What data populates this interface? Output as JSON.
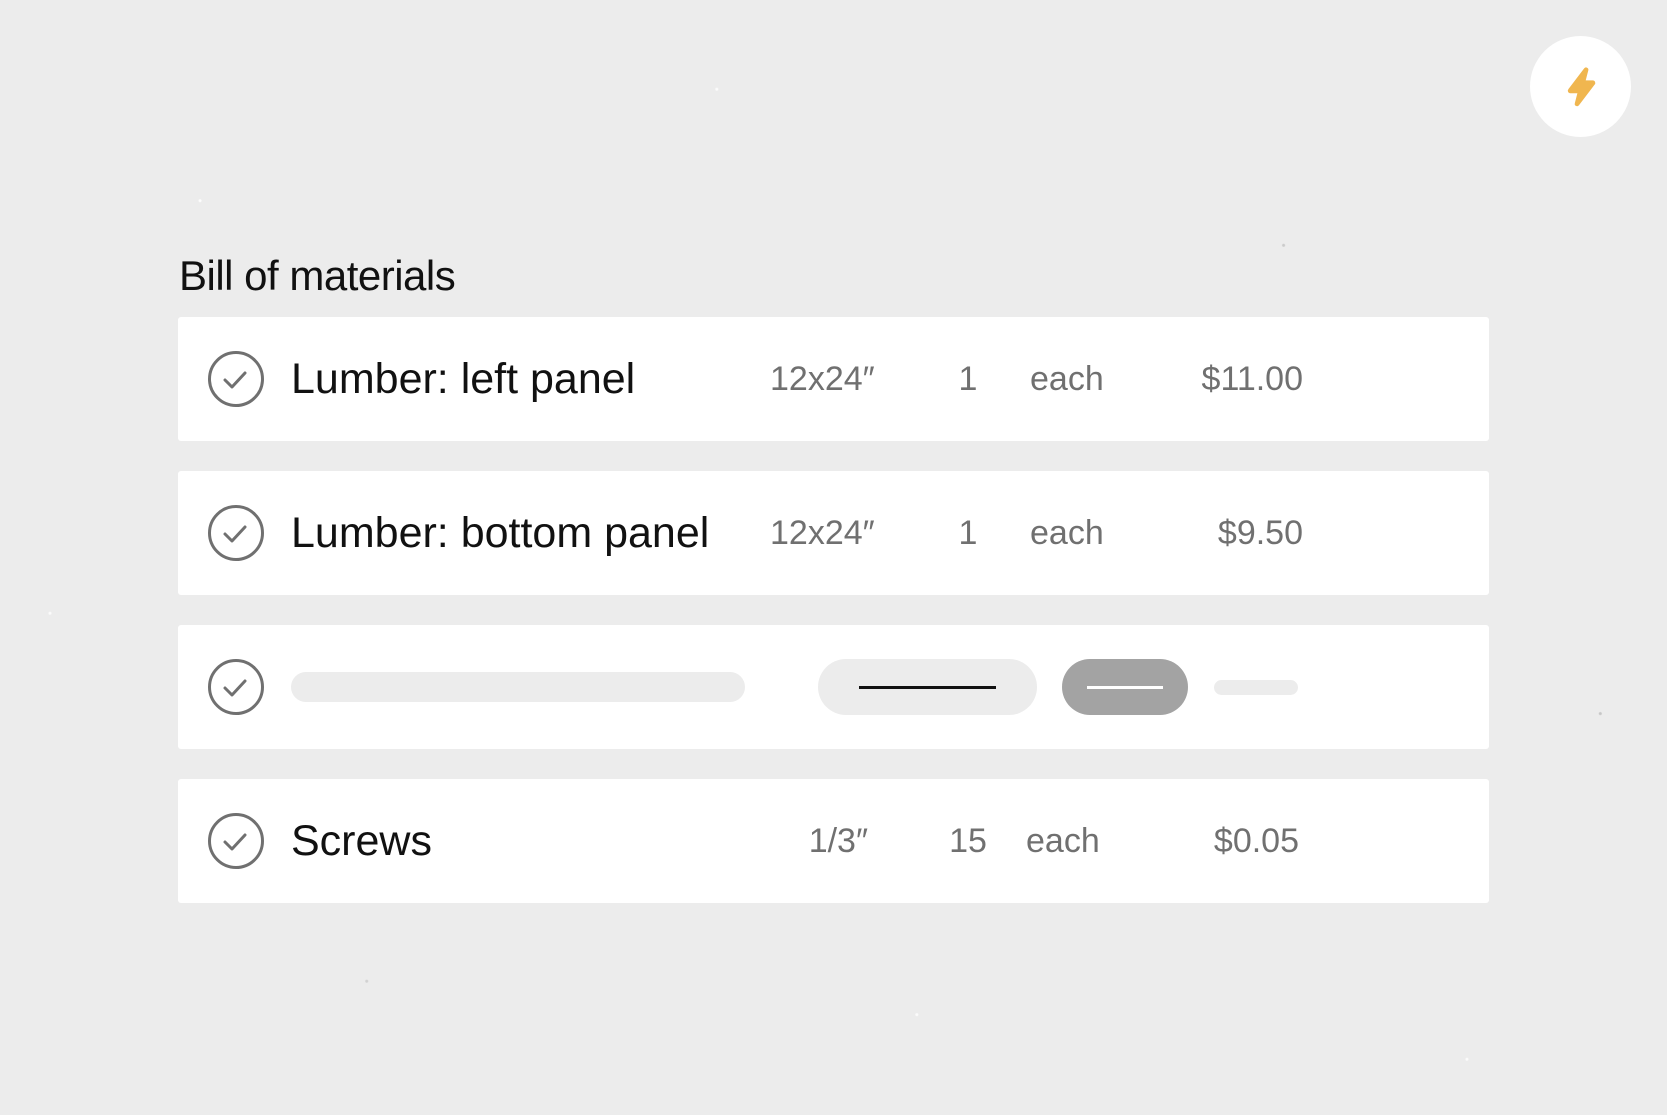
{
  "action_button": {
    "icon": "lightning-bolt-icon",
    "color": "#f0b64f"
  },
  "heading": "Bill of materials",
  "items": [
    {
      "name": "Lumber: left panel",
      "size": "12x24″",
      "quantity": "1",
      "unit": "each",
      "price": "$11.00",
      "checked": true
    },
    {
      "name": "Lumber: bottom panel",
      "size": "12x24″",
      "quantity": "1",
      "unit": "each",
      "price": "$9.50",
      "checked": true
    },
    {
      "placeholder": true,
      "checked": true
    },
    {
      "name": "Screws",
      "size": "1/3″",
      "quantity": "15",
      "unit": "each",
      "price": "$0.05",
      "checked": true
    }
  ],
  "colors": {
    "background": "#ececec",
    "row": "#ffffff",
    "text_primary": "#111111",
    "text_secondary": "#707070",
    "check": "#707070",
    "placeholder_dark": "#a3a3a3"
  }
}
